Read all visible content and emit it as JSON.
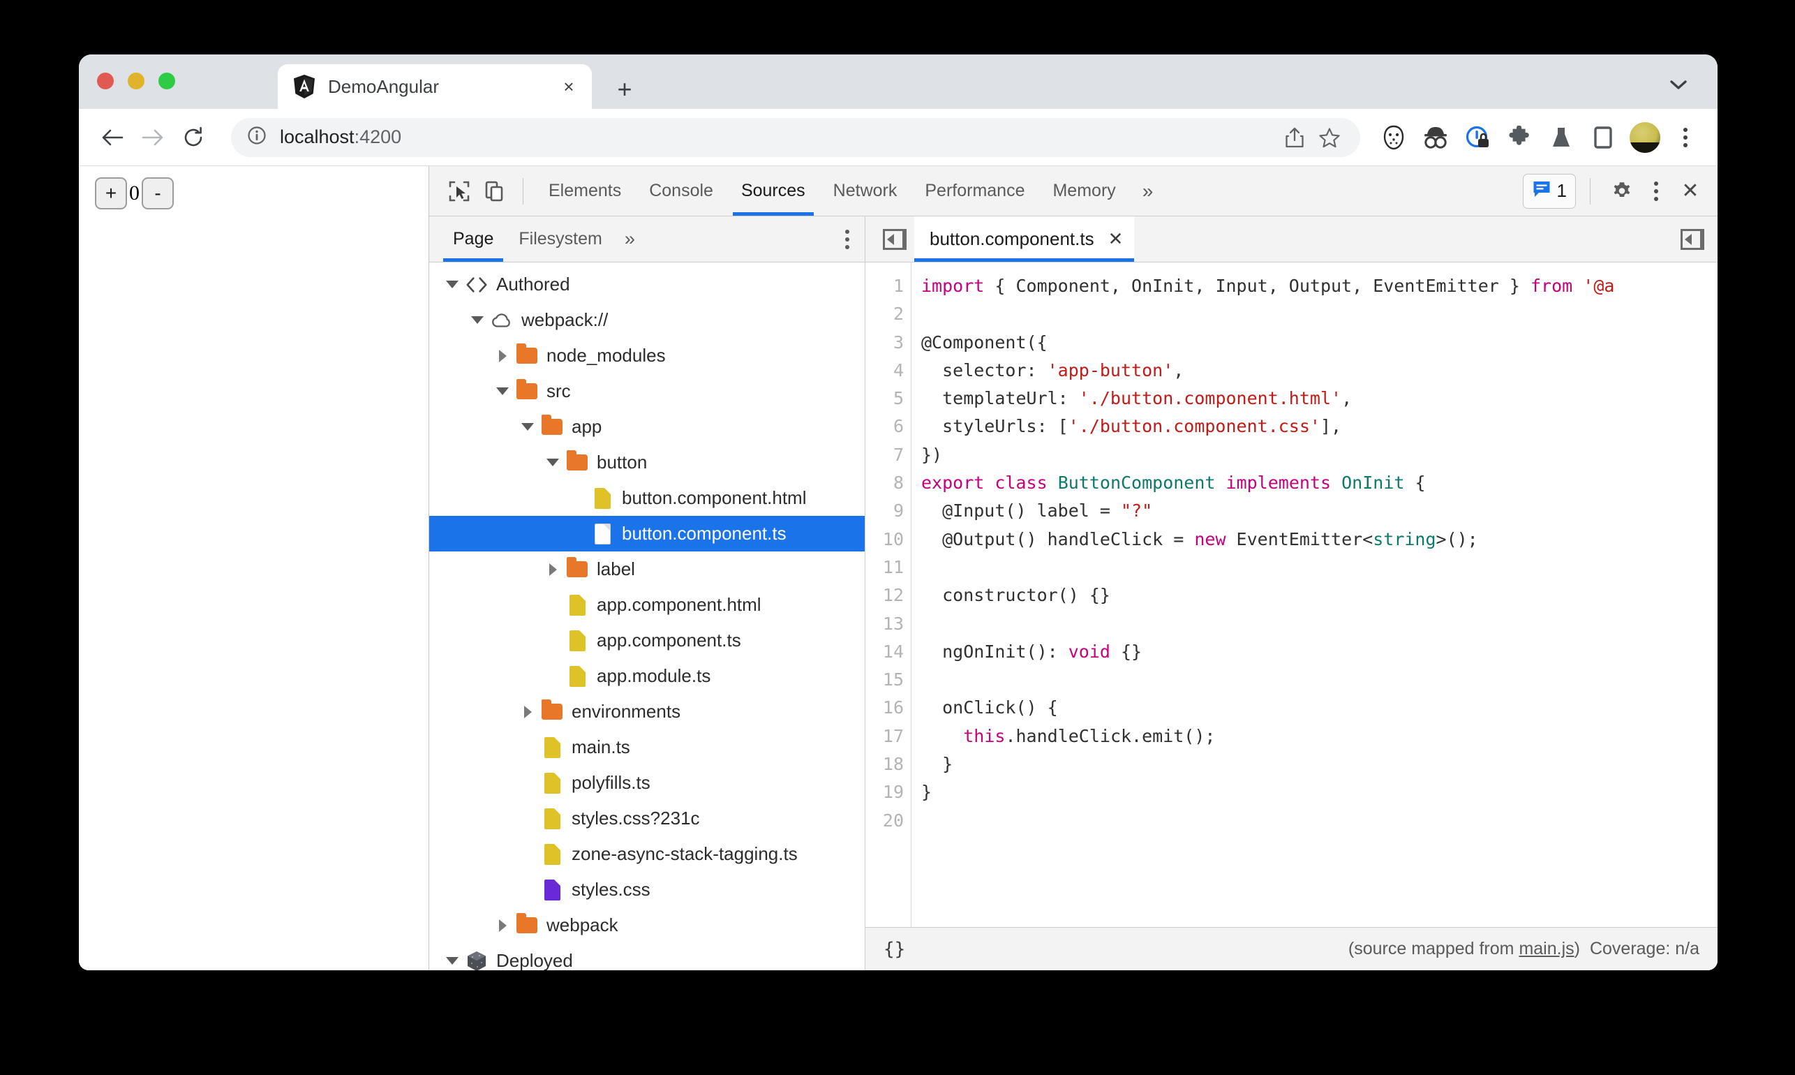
{
  "browser": {
    "tab": {
      "title": "DemoAngular",
      "close_label": "×"
    },
    "new_tab_label": "+",
    "window_chevron": "chevron-down",
    "omnibox": {
      "url_host": "localhost",
      "url_port": ":4200"
    },
    "nav": {
      "back": "←",
      "forward": "→",
      "reload": "↻"
    }
  },
  "page": {
    "increment_label": "+",
    "counter_value": "0",
    "decrement_label": "-"
  },
  "devtools": {
    "tabs": [
      {
        "label": "Elements",
        "active": false
      },
      {
        "label": "Console",
        "active": false
      },
      {
        "label": "Sources",
        "active": true
      },
      {
        "label": "Network",
        "active": false
      },
      {
        "label": "Performance",
        "active": false
      },
      {
        "label": "Memory",
        "active": false
      }
    ],
    "more_label": "»",
    "message_count": "1",
    "close_label": "✕"
  },
  "navigator": {
    "tabs": [
      {
        "label": "Page",
        "active": true
      },
      {
        "label": "Filesystem",
        "active": false
      }
    ],
    "more_label": "»",
    "tree": [
      {
        "label": "Authored",
        "indent": 0,
        "twisty": "down",
        "icon": "code-brackets"
      },
      {
        "label": "webpack://",
        "indent": 1,
        "twisty": "down",
        "icon": "cloud"
      },
      {
        "label": "node_modules",
        "indent": 2,
        "twisty": "right",
        "icon": "folder"
      },
      {
        "label": "src",
        "indent": 2,
        "twisty": "down",
        "icon": "folder"
      },
      {
        "label": "app",
        "indent": 3,
        "twisty": "down",
        "icon": "folder"
      },
      {
        "label": "button",
        "indent": 4,
        "twisty": "down",
        "icon": "folder"
      },
      {
        "label": "button.component.html",
        "indent": 5,
        "twisty": "none",
        "icon": "doc-yellow"
      },
      {
        "label": "button.component.ts",
        "indent": 5,
        "twisty": "none",
        "icon": "doc-white",
        "selected": true
      },
      {
        "label": "label",
        "indent": 4,
        "twisty": "right",
        "icon": "folder"
      },
      {
        "label": "app.component.html",
        "indent": 4,
        "twisty": "none",
        "icon": "doc-yellow"
      },
      {
        "label": "app.component.ts",
        "indent": 4,
        "twisty": "none",
        "icon": "doc-yellow"
      },
      {
        "label": "app.module.ts",
        "indent": 4,
        "twisty": "none",
        "icon": "doc-yellow"
      },
      {
        "label": "environments",
        "indent": 3,
        "twisty": "right",
        "icon": "folder"
      },
      {
        "label": "main.ts",
        "indent": 3,
        "twisty": "none",
        "icon": "doc-yellow"
      },
      {
        "label": "polyfills.ts",
        "indent": 3,
        "twisty": "none",
        "icon": "doc-yellow"
      },
      {
        "label": "styles.css?231c",
        "indent": 3,
        "twisty": "none",
        "icon": "doc-yellow"
      },
      {
        "label": "zone-async-stack-tagging.ts",
        "indent": 3,
        "twisty": "none",
        "icon": "doc-yellow"
      },
      {
        "label": "styles.css",
        "indent": 3,
        "twisty": "none",
        "icon": "doc-purple"
      },
      {
        "label": "webpack",
        "indent": 2,
        "twisty": "right",
        "icon": "folder"
      },
      {
        "label": "Deployed",
        "indent": 0,
        "twisty": "down",
        "icon": "cube"
      }
    ]
  },
  "editor": {
    "file_tab": {
      "label": "button.component.ts",
      "close_label": "✕"
    },
    "line_numbers": [
      "1",
      "2",
      "3",
      "4",
      "5",
      "6",
      "7",
      "8",
      "9",
      "10",
      "11",
      "12",
      "13",
      "14",
      "15",
      "16",
      "17",
      "18",
      "19",
      "20"
    ],
    "code_lines": [
      [
        {
          "t": "import",
          "c": "kw"
        },
        {
          "t": " { Component, OnInit, Input, Output, EventEmitter } ",
          "c": "pln"
        },
        {
          "t": "from",
          "c": "kw"
        },
        {
          "t": " ",
          "c": "pln"
        },
        {
          "t": "'@a",
          "c": "str"
        }
      ],
      [],
      [
        {
          "t": "@Component({",
          "c": "pln"
        }
      ],
      [
        {
          "t": "  selector: ",
          "c": "pln"
        },
        {
          "t": "'app-button'",
          "c": "str"
        },
        {
          "t": ",",
          "c": "pln"
        }
      ],
      [
        {
          "t": "  templateUrl: ",
          "c": "pln"
        },
        {
          "t": "'./button.component.html'",
          "c": "str"
        },
        {
          "t": ",",
          "c": "pln"
        }
      ],
      [
        {
          "t": "  styleUrls: [",
          "c": "pln"
        },
        {
          "t": "'./button.component.css'",
          "c": "str"
        },
        {
          "t": "],",
          "c": "pln"
        }
      ],
      [
        {
          "t": "})",
          "c": "pln"
        }
      ],
      [
        {
          "t": "export class",
          "c": "kw"
        },
        {
          "t": " ",
          "c": "pln"
        },
        {
          "t": "ButtonComponent",
          "c": "type"
        },
        {
          "t": " ",
          "c": "pln"
        },
        {
          "t": "implements",
          "c": "kw"
        },
        {
          "t": " ",
          "c": "pln"
        },
        {
          "t": "OnInit",
          "c": "type"
        },
        {
          "t": " {",
          "c": "pln"
        }
      ],
      [
        {
          "t": "  @Input() label = ",
          "c": "pln"
        },
        {
          "t": "\"?\"",
          "c": "str"
        }
      ],
      [
        {
          "t": "  @Output() handleClick = ",
          "c": "pln"
        },
        {
          "t": "new",
          "c": "kw"
        },
        {
          "t": " EventEmitter<",
          "c": "pln"
        },
        {
          "t": "string",
          "c": "type"
        },
        {
          "t": ">();",
          "c": "pln"
        }
      ],
      [],
      [
        {
          "t": "  constructor() {}",
          "c": "pln"
        }
      ],
      [],
      [
        {
          "t": "  ngOnInit(): ",
          "c": "pln"
        },
        {
          "t": "void",
          "c": "kw"
        },
        {
          "t": " {}",
          "c": "pln"
        }
      ],
      [],
      [
        {
          "t": "  onClick() {",
          "c": "pln"
        }
      ],
      [
        {
          "t": "    ",
          "c": "pln"
        },
        {
          "t": "this",
          "c": "kw"
        },
        {
          "t": ".handleClick.emit();",
          "c": "pln"
        }
      ],
      [
        {
          "t": "  }",
          "c": "pln"
        }
      ],
      [
        {
          "t": "}",
          "c": "pln"
        }
      ],
      []
    ],
    "status": {
      "pretty_print": "{}",
      "source_mapped_prefix": "(source mapped from ",
      "source_mapped_link": "main.js",
      "source_mapped_suffix": ")",
      "coverage": "Coverage: n/a"
    }
  },
  "colors": {
    "accent": "#1a73e8",
    "folder": "#e8772a",
    "doc_yellow": "#dfc227",
    "doc_purple": "#6a29d6",
    "string": "#c41a16",
    "keyword": "#c6007f",
    "type": "#0b7a6b"
  }
}
